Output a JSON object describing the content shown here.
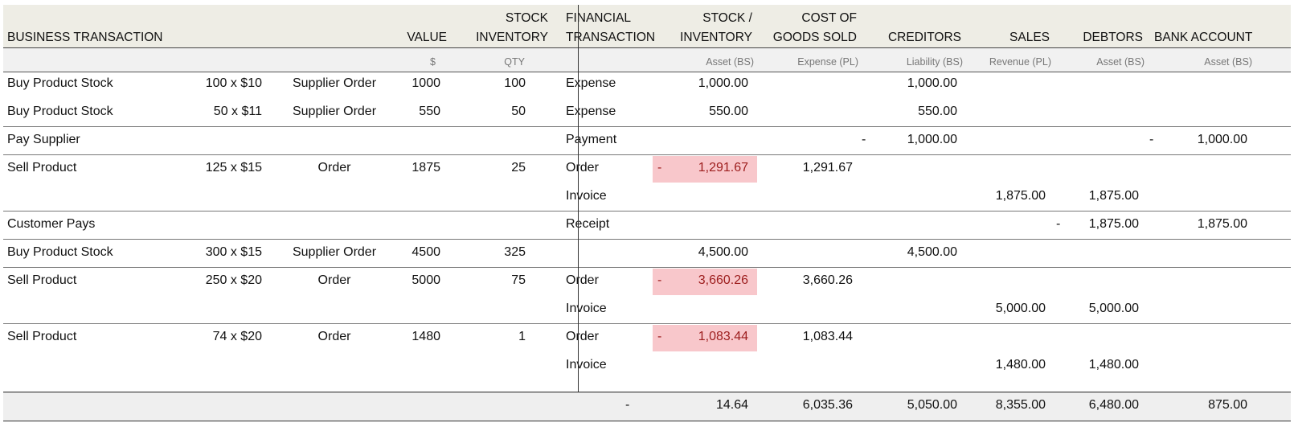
{
  "header": {
    "business_transaction": "BUSINESS TRANSACTION",
    "value": "VALUE",
    "stock_inventory": [
      "STOCK",
      "INVENTORY"
    ],
    "financial_transaction": [
      "FINANCIAL",
      "TRANSACTION"
    ],
    "stock_inventory_acct": [
      "STOCK /",
      "INVENTORY"
    ],
    "cogs": [
      "COST OF",
      "GOODS SOLD"
    ],
    "creditors": "CREDITORS",
    "sales": "SALES",
    "debtors": "DEBTORS",
    "bank_account": "BANK ACCOUNT"
  },
  "subheader": {
    "value_unit": "$",
    "qty_unit": "QTY",
    "stock_type": "Asset (BS)",
    "cogs_type": "Expense (PL)",
    "creditors_type": "Liability (BS)",
    "sales_type": "Revenue (PL)",
    "debtors_type": "Asset (BS)",
    "bank_type": "Asset (BS)"
  },
  "rows": [
    {
      "desc": "Buy Product Stock",
      "qty_price": "100 x $10",
      "order": "Supplier Order",
      "value": "1000",
      "stock_qty": "100",
      "ftype": "Expense",
      "stock": "1,000.00",
      "stock_sign": "",
      "cogs": "",
      "cred_sign": "",
      "creditors": "1,000.00",
      "sales": "",
      "debt_sign": "",
      "debtors": "",
      "bank_sign": "",
      "bank": ""
    },
    {
      "desc": "Buy Product Stock",
      "qty_price": "50 x $11",
      "order": "Supplier Order",
      "value": "550",
      "stock_qty": "50",
      "ftype": "Expense",
      "stock": "550.00",
      "stock_sign": "",
      "cogs": "",
      "cred_sign": "",
      "creditors": "550.00",
      "sales": "",
      "debt_sign": "",
      "debtors": "",
      "bank_sign": "",
      "bank": ""
    },
    {
      "desc": "Pay Supplier",
      "qty_price": "",
      "order": "",
      "value": "",
      "stock_qty": "",
      "ftype": "Payment",
      "stock": "",
      "stock_sign": "",
      "cogs": "",
      "cred_sign": "-",
      "creditors": "1,000.00",
      "sales": "",
      "debt_sign": "",
      "debtors": "",
      "bank_sign": "-",
      "bank": "1,000.00"
    },
    {
      "desc": "Sell Product",
      "qty_price": "125 x $15",
      "order": "Order",
      "value": "1875",
      "stock_qty": "25",
      "ftype": "Order",
      "stock": "1,291.67",
      "stock_sign": "-",
      "cogs": "1,291.67",
      "cred_sign": "",
      "creditors": "",
      "sales": "",
      "debt_sign": "",
      "debtors": "",
      "bank_sign": "",
      "bank": ""
    },
    {
      "desc": "",
      "qty_price": "",
      "order": "",
      "value": "",
      "stock_qty": "",
      "ftype": "Invoice",
      "stock": "",
      "stock_sign": "",
      "cogs": "",
      "cred_sign": "",
      "creditors": "",
      "sales": "1,875.00",
      "debt_sign": "",
      "debtors": "1,875.00",
      "bank_sign": "",
      "bank": ""
    },
    {
      "desc": "Customer Pays",
      "qty_price": "",
      "order": "",
      "value": "",
      "stock_qty": "",
      "ftype": "Receipt",
      "stock": "",
      "stock_sign": "",
      "cogs": "",
      "cred_sign": "",
      "creditors": "",
      "sales": "",
      "debt_sign": "-",
      "debtors": "1,875.00",
      "bank_sign": "",
      "bank": "1,875.00"
    },
    {
      "desc": "Buy Product Stock",
      "qty_price": "300 x $15",
      "order": "Supplier Order",
      "value": "4500",
      "stock_qty": "325",
      "ftype": "",
      "stock": "4,500.00",
      "stock_sign": "",
      "cogs": "",
      "cred_sign": "",
      "creditors": "4,500.00",
      "sales": "",
      "debt_sign": "",
      "debtors": "",
      "bank_sign": "",
      "bank": ""
    },
    {
      "desc": "Sell Product",
      "qty_price": "250 x $20",
      "order": "Order",
      "value": "5000",
      "stock_qty": "75",
      "ftype": "Order",
      "stock": "3,660.26",
      "stock_sign": "-",
      "cogs": "3,660.26",
      "cred_sign": "",
      "creditors": "",
      "sales": "",
      "debt_sign": "",
      "debtors": "",
      "bank_sign": "",
      "bank": ""
    },
    {
      "desc": "",
      "qty_price": "",
      "order": "",
      "value": "",
      "stock_qty": "",
      "ftype": "Invoice",
      "stock": "",
      "stock_sign": "",
      "cogs": "",
      "cred_sign": "",
      "creditors": "",
      "sales": "5,000.00",
      "debt_sign": "",
      "debtors": "5,000.00",
      "bank_sign": "",
      "bank": ""
    },
    {
      "desc": "Sell Product",
      "qty_price": "74 x $20",
      "order": "Order",
      "value": "1480",
      "stock_qty": "1",
      "ftype": "Order",
      "stock": "1,083.44",
      "stock_sign": "-",
      "cogs": "1,083.44",
      "cred_sign": "",
      "creditors": "",
      "sales": "",
      "debt_sign": "",
      "debtors": "",
      "bank_sign": "",
      "bank": ""
    },
    {
      "desc": "",
      "qty_price": "",
      "order": "",
      "value": "",
      "stock_qty": "",
      "ftype": "Invoice",
      "stock": "",
      "stock_sign": "",
      "cogs": "",
      "cred_sign": "",
      "creditors": "",
      "sales": "1,480.00",
      "debt_sign": "",
      "debtors": "1,480.00",
      "bank_sign": "",
      "bank": ""
    }
  ],
  "totals": {
    "sign": "-",
    "stock": "14.64",
    "cogs": "6,035.36",
    "creditors": "5,050.00",
    "sales": "8,355.00",
    "debtors": "6,480.00",
    "bank": "875.00"
  },
  "colors": {
    "header_bg": "#eeede5",
    "negative_bg": "#f8c7cb",
    "negative_text": "#9c1c1c"
  }
}
